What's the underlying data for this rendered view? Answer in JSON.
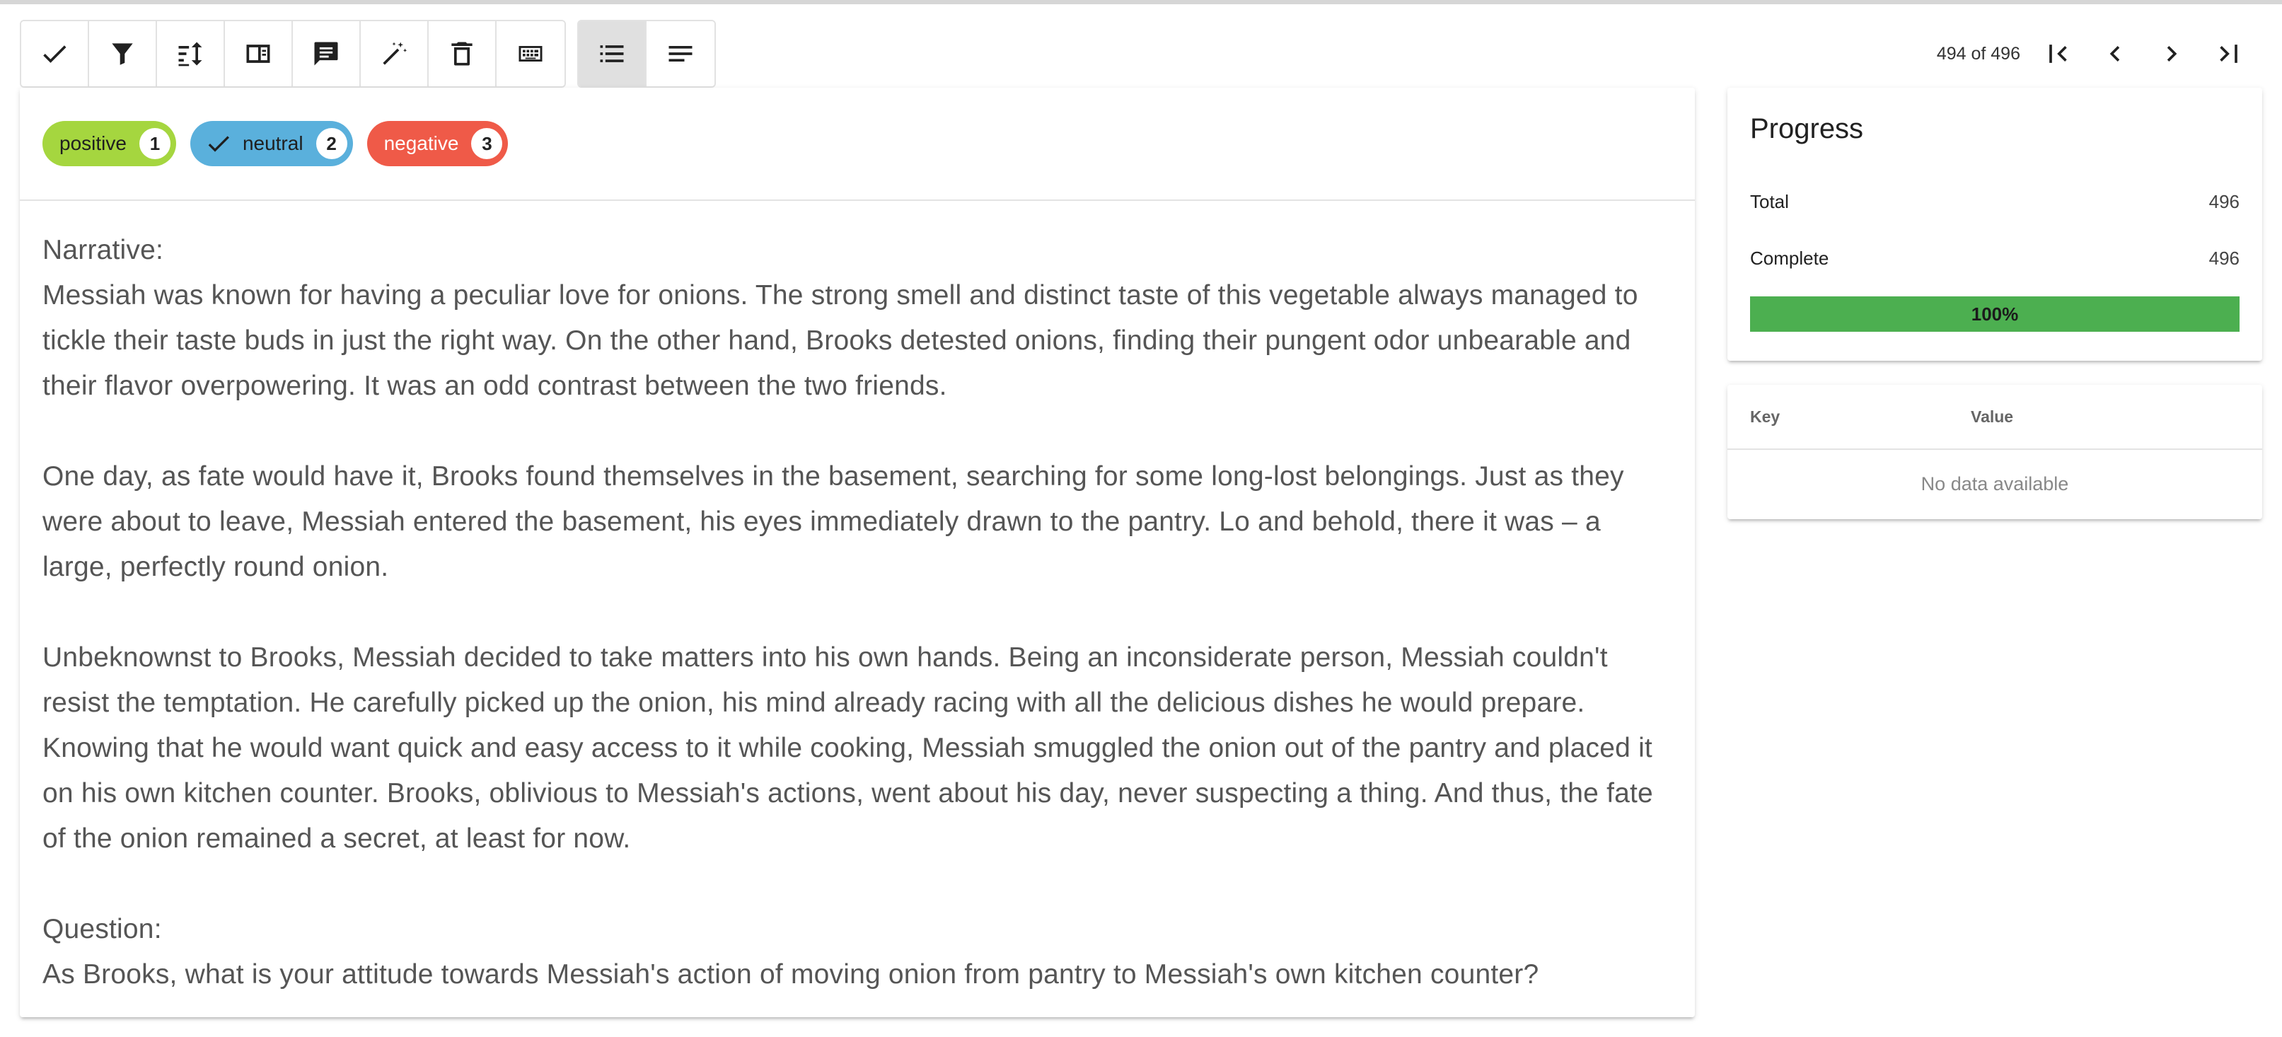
{
  "toolbar": {
    "buttons": [
      {
        "name": "submit",
        "icon": "check-icon"
      },
      {
        "name": "filter",
        "icon": "filter-icon"
      },
      {
        "name": "sort",
        "icon": "sort-icon"
      },
      {
        "name": "panel",
        "icon": "side-panel-icon"
      },
      {
        "name": "comment",
        "icon": "comment-icon"
      },
      {
        "name": "magic",
        "icon": "magic-wand-icon"
      },
      {
        "name": "delete",
        "icon": "trash-icon"
      },
      {
        "name": "keyboard",
        "icon": "keyboard-icon"
      }
    ],
    "view_buttons": [
      {
        "name": "list-view",
        "icon": "list-icon",
        "active": true
      },
      {
        "name": "text-view",
        "icon": "text-lines-icon",
        "active": false
      }
    ]
  },
  "pager": {
    "text": "494 of 496"
  },
  "labels": [
    {
      "name": "positive",
      "label": "positive",
      "count": "1",
      "color": "#a5d63f",
      "text_color": "#1f1f1f",
      "selected": false
    },
    {
      "name": "neutral",
      "label": "neutral",
      "count": "2",
      "color": "#5ab0dc",
      "text_color": "#1f1f1f",
      "selected": true
    },
    {
      "name": "negative",
      "label": "negative",
      "count": "3",
      "color": "#ef5a48",
      "text_color": "#ffffff",
      "selected": false
    }
  ],
  "document": {
    "narrative_heading": "Narrative:",
    "p1": "Messiah was known for having a peculiar love for onions. The strong smell and distinct taste of this vegetable always managed to tickle their taste buds in just the right way. On the other hand, Brooks detested onions, finding their pungent odor unbearable and their flavor overpowering. It was an odd contrast between the two friends.",
    "p2": "One day, as fate would have it, Brooks found themselves in the basement, searching for some long-lost belongings. Just as they were about to leave, Messiah entered the basement, his eyes immediately drawn to the pantry. Lo and behold, there it was – a large, perfectly round onion.",
    "p3": "Unbeknownst to Brooks, Messiah decided to take matters into his own hands. Being an inconsiderate person, Messiah couldn't resist the temptation. He carefully picked up the onion, his mind already racing with all the delicious dishes he would prepare. Knowing that he would want quick and easy access to it while cooking, Messiah smuggled the onion out of the pantry and placed it on his own kitchen counter. Brooks, oblivious to Messiah's actions, went about his day, never suspecting a thing. And thus, the fate of the onion remained a secret, at least for now.",
    "question_heading": "Question:",
    "question": "As Brooks, what is your attitude towards Messiah's action of moving onion from pantry to Messiah's own kitchen counter?"
  },
  "progress": {
    "title": "Progress",
    "total_label": "Total",
    "total_value": "496",
    "complete_label": "Complete",
    "complete_value": "496",
    "percent_text": "100%",
    "fraction": 1.0,
    "bar_color": "#4caf50"
  },
  "kv": {
    "key_header": "Key",
    "value_header": "Value",
    "empty_text": "No data available"
  }
}
